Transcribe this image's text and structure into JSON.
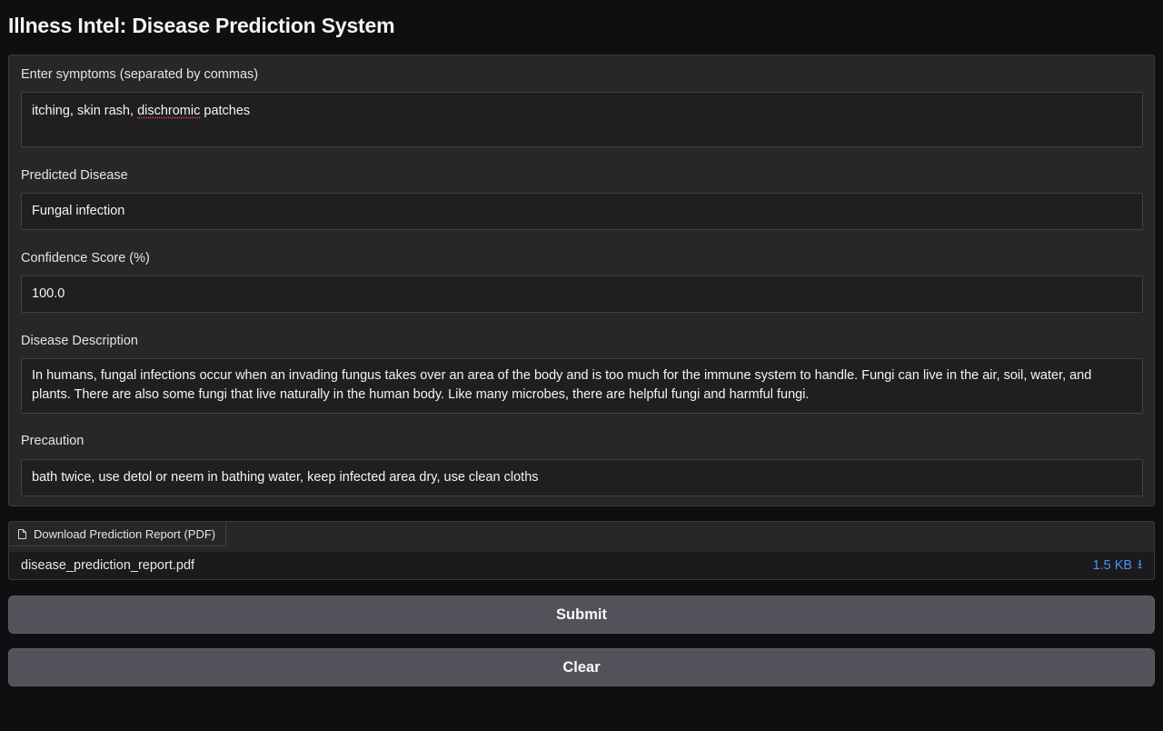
{
  "app": {
    "title": "Illness Intel: Disease Prediction System"
  },
  "symptoms": {
    "label": "Enter symptoms (separated by commas)",
    "value_part1": "itching, skin rash, ",
    "value_misspelled": "dischromic",
    "value_part2": " patches"
  },
  "predicted": {
    "label": "Predicted Disease",
    "value": "Fungal infection"
  },
  "confidence": {
    "label": "Confidence Score (%)",
    "value": "100.0"
  },
  "description": {
    "label": "Disease Description",
    "value": "In humans, fungal infections occur when an invading fungus takes over an area of the body and is too much for the immune system to handle. Fungi can live in the air, soil, water, and plants. There are also some fungi that live naturally in the human body. Like many microbes, there are helpful fungi and harmful fungi."
  },
  "precaution": {
    "label": "Precaution",
    "value": "bath twice, use detol or neem in bathing water, keep infected area dry, use clean cloths"
  },
  "download": {
    "tab_label": "Download Prediction Report (PDF)",
    "file_name": "disease_prediction_report.pdf",
    "file_size": "1.5 KB",
    "icon": "download-icon"
  },
  "buttons": {
    "submit": "Submit",
    "clear": "Clear"
  },
  "colors": {
    "accent_link": "#4f8ff7",
    "button_bg": "#52525b",
    "panel_bg": "#27272a",
    "page_bg": "#0f0f11"
  }
}
